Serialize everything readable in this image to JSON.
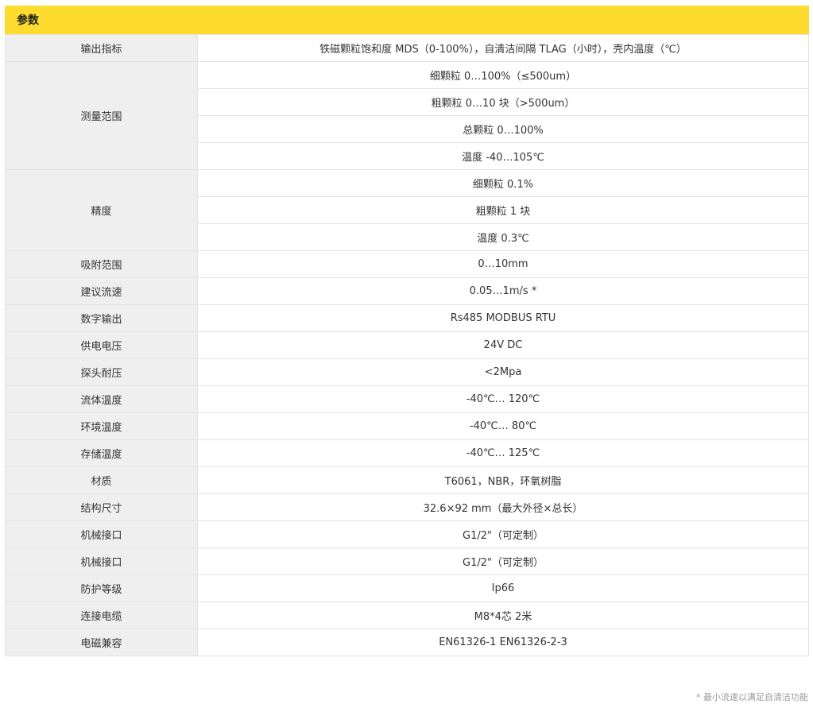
{
  "header": {
    "title": "参数"
  },
  "rows": [
    {
      "label": "输出指标",
      "values": [
        "铁磁颗粒饱和度 MDS（0-100%），自清洁间隔 TLAG（小时），壳内温度（℃）"
      ]
    },
    {
      "label": "测量范围",
      "values": [
        "细颗粒 0…100%（≤500um）",
        "粗颗粒 0…10 块（>500um）",
        "总颗粒 0…100%",
        "温度 -40…105℃"
      ]
    },
    {
      "label": "精度",
      "values": [
        "细颗粒 0.1%",
        "粗颗粒 1 块",
        "温度 0.3℃"
      ]
    },
    {
      "label": "吸附范围",
      "values": [
        "0…10mm"
      ]
    },
    {
      "label": "建议流速",
      "values": [
        "0.05…1m/s *"
      ]
    },
    {
      "label": "数字输出",
      "values": [
        "Rs485 MODBUS RTU"
      ]
    },
    {
      "label": "供电电压",
      "values": [
        "24V DC"
      ]
    },
    {
      "label": "探头耐压",
      "values": [
        "<2Mpa"
      ]
    },
    {
      "label": "流体温度",
      "values": [
        "-40℃… 120℃"
      ]
    },
    {
      "label": "环境温度",
      "values": [
        "-40℃… 80℃"
      ]
    },
    {
      "label": "存储温度",
      "values": [
        "-40℃… 125℃"
      ]
    },
    {
      "label": "材质",
      "values": [
        "T6061，NBR，环氧树脂"
      ]
    },
    {
      "label": "结构尺寸",
      "values": [
        "32.6×92 mm（最大外径×总长）"
      ]
    },
    {
      "label": "机械接口",
      "values": [
        "G1/2\"（可定制）"
      ]
    },
    {
      "label": "机械接口",
      "values": [
        "G1/2\"（可定制）"
      ]
    },
    {
      "label": "防护等级",
      "values": [
        "Ip66"
      ]
    },
    {
      "label": "连接电缆",
      "values": [
        "M8*4芯 2米"
      ]
    },
    {
      "label": "电磁兼容",
      "values": [
        "EN61326-1 EN61326-2-3"
      ]
    }
  ],
  "footnote": "* 最小流速以满足自清洁功能"
}
